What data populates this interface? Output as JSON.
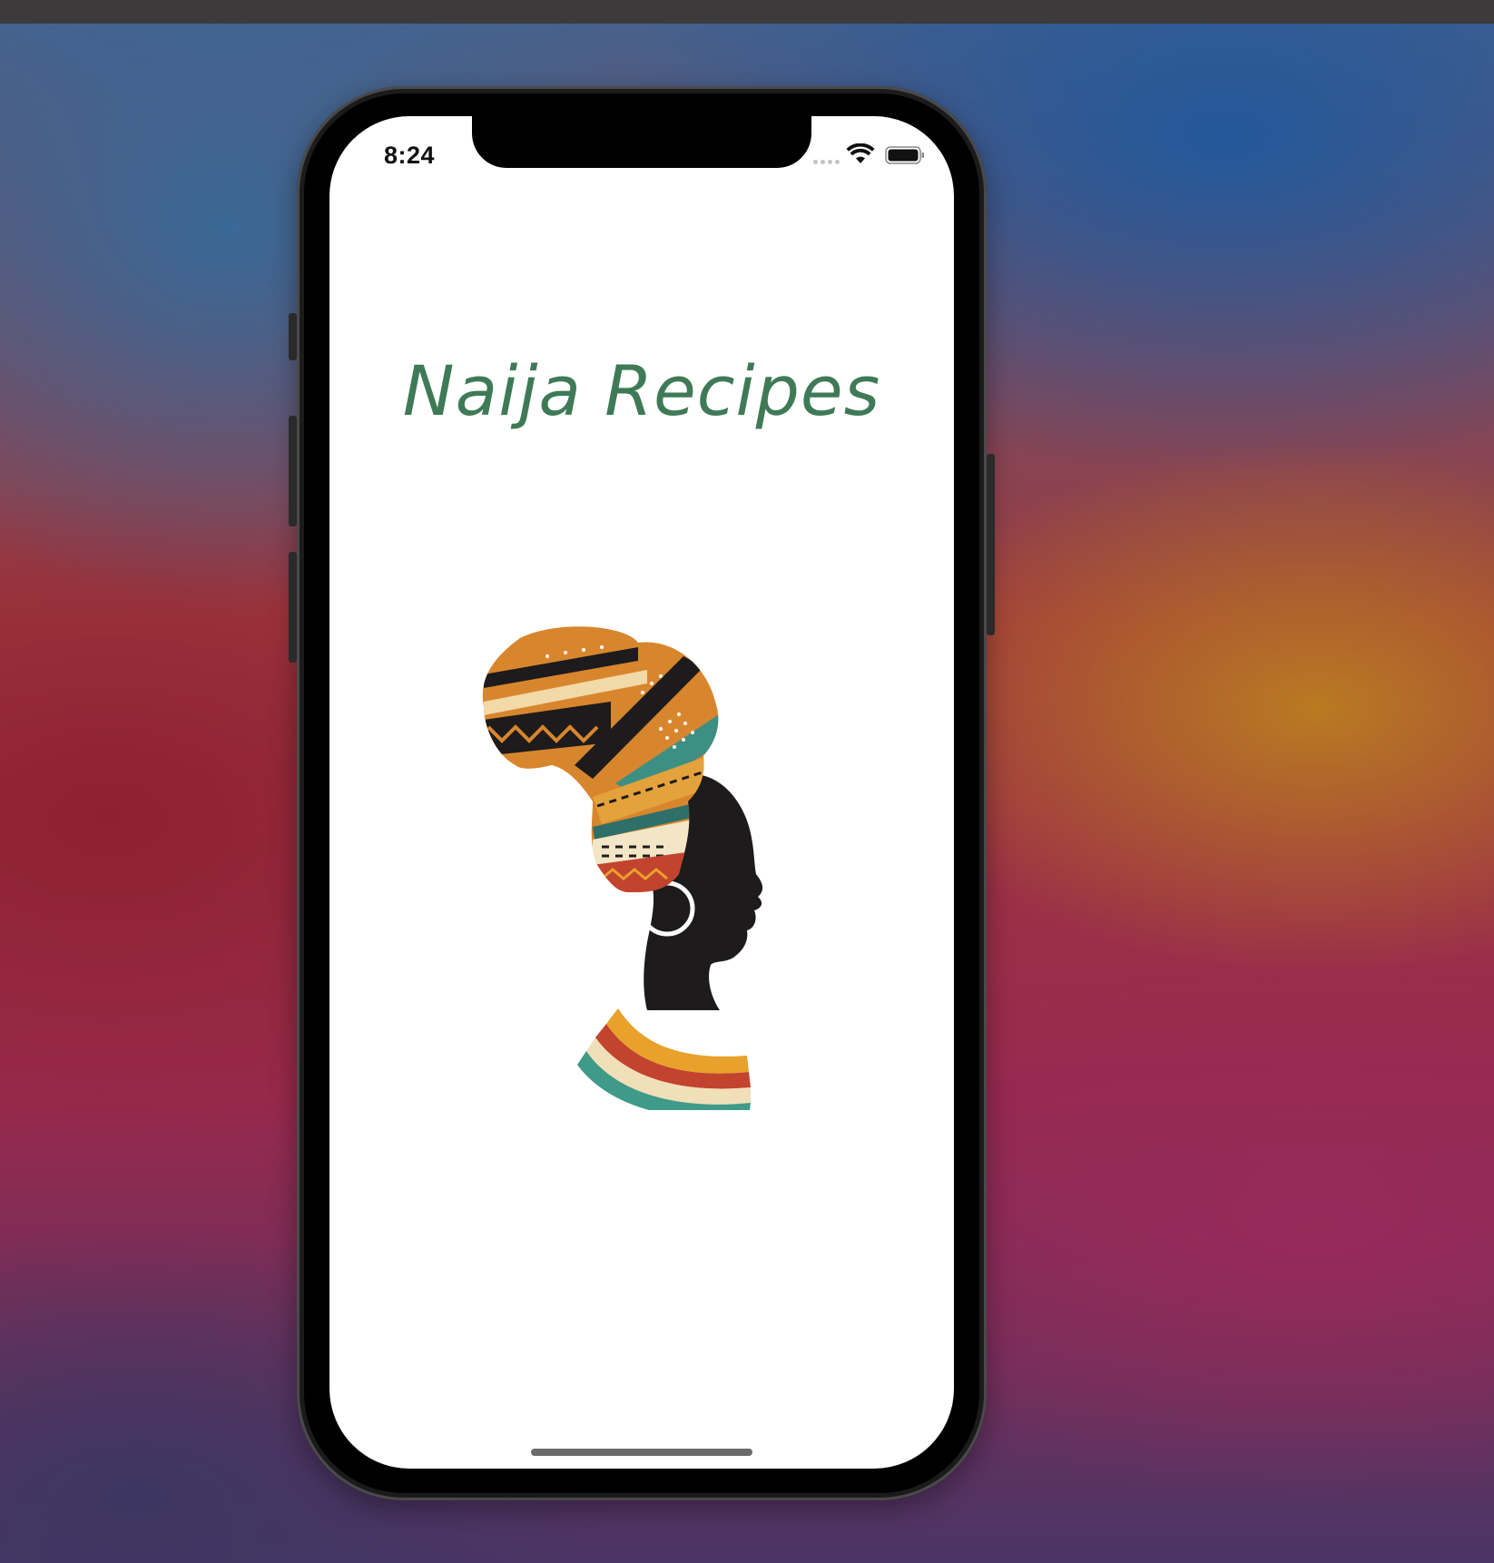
{
  "status_bar": {
    "time": "8:24",
    "wifi_icon": "wifi-icon",
    "battery_icon": "battery-icon"
  },
  "app": {
    "title": "Naija Recipes",
    "title_color": "#3f7a57",
    "logo_icon": "african-woman-headwrap-illustration"
  },
  "colors": {
    "screen_background": "#ffffff",
    "phone_bezel": "#000000"
  }
}
